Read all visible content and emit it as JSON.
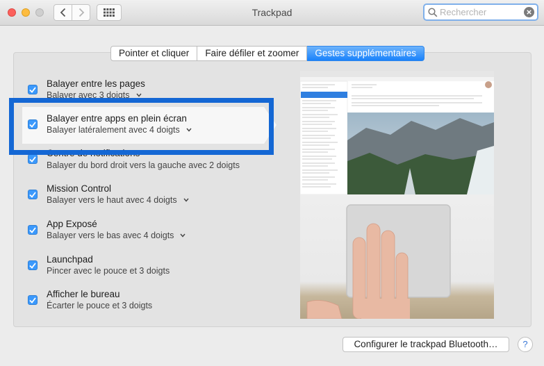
{
  "window": {
    "title": "Trackpad"
  },
  "search": {
    "placeholder": "Rechercher",
    "value": ""
  },
  "tabs": [
    {
      "label": "Pointer et cliquer",
      "active": false
    },
    {
      "label": "Faire défiler et zoomer",
      "active": false
    },
    {
      "label": "Gestes supplémentaires",
      "active": true
    }
  ],
  "gestures": [
    {
      "title": "Balayer entre les pages",
      "subtitle": "Balayer avec 3 doigts",
      "checked": true,
      "has_menu": true
    },
    {
      "title": "Balayer entre apps en plein écran",
      "subtitle": "Balayer latéralement avec 4 doigts",
      "checked": true,
      "has_menu": true,
      "selected": true
    },
    {
      "title": "Centre de notifications",
      "subtitle": "Balayer du bord droit vers la gauche avec 2 doigts",
      "checked": true,
      "has_menu": false
    },
    {
      "title": "Mission Control",
      "subtitle": "Balayer vers le haut avec 4 doigts",
      "checked": true,
      "has_menu": true
    },
    {
      "title": "App Exposé",
      "subtitle": "Balayer vers le bas avec 4 doigts",
      "checked": true,
      "has_menu": true
    },
    {
      "title": "Launchpad",
      "subtitle": "Pincer avec le pouce et 3 doigts",
      "checked": true,
      "has_menu": false
    },
    {
      "title": "Afficher le bureau",
      "subtitle": "Écarter le pouce et 3 doigts",
      "checked": true,
      "has_menu": false
    }
  ],
  "buttons": {
    "configure": "Configurer le trackpad Bluetooth…",
    "help": "?"
  },
  "colors": {
    "accent": "#3b99fc",
    "highlight": "#1467d4",
    "tab_active": "#1a82fb"
  }
}
